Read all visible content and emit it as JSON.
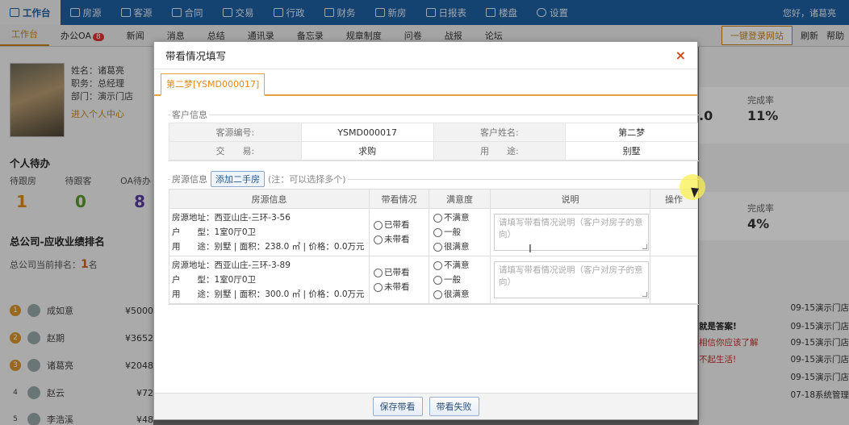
{
  "topnav": {
    "tabs": [
      {
        "label": "工作台",
        "icon": "grid-icon"
      },
      {
        "label": "房源",
        "icon": "home-icon"
      },
      {
        "label": "客源",
        "icon": "users-icon"
      },
      {
        "label": "合同",
        "icon": "contract-icon"
      },
      {
        "label": "交易",
        "icon": "trade-icon"
      },
      {
        "label": "行政",
        "icon": "admin-icon"
      },
      {
        "label": "财务",
        "icon": "finance-icon"
      },
      {
        "label": "新房",
        "icon": "newhouse-icon"
      },
      {
        "label": "日报表",
        "icon": "report-icon"
      },
      {
        "label": "楼盘",
        "icon": "building-icon"
      },
      {
        "label": "设置",
        "icon": "gear-icon"
      }
    ],
    "greeting": "您好，诸葛亮"
  },
  "subnav": {
    "items": [
      "工作台",
      "办公OA",
      "新闻",
      "消息",
      "总结",
      "通讯录",
      "备忘录",
      "规章制度",
      "问卷",
      "战报",
      "论坛"
    ],
    "oa_badge": "8",
    "login_btn": "一键登录网站",
    "refresh": "刷新",
    "help": "帮助"
  },
  "profile": {
    "name": "姓名：诸葛亮",
    "title": "职务：总经理",
    "dept": "部门：演示门店",
    "enter": "进入个人中心"
  },
  "todo": {
    "title": "个人待办",
    "labels": [
      "待跟房",
      "待跟客",
      "OA待办"
    ],
    "values": [
      "1",
      "0",
      "8"
    ],
    "value_colors": [
      "#e08a1a",
      "#5a9a2a",
      "#5a3aa0"
    ]
  },
  "ranking": {
    "title": "总公司-应收业绩排名",
    "line_prefix": "总公司当前排名：",
    "line_rank": "1",
    "line_suffix": "名",
    "rows": [
      {
        "no": "1",
        "name": "成如意",
        "amount": "¥5000"
      },
      {
        "no": "2",
        "name": "赵期",
        "amount": "¥3652"
      },
      {
        "no": "3",
        "name": "诸葛亮",
        "amount": "¥2048"
      },
      {
        "no": "4",
        "name": "赵云",
        "amount": "¥72"
      },
      {
        "no": "5",
        "name": "李浩溪",
        "amount": "¥48"
      }
    ]
  },
  "right_panel": {
    "rate_label": "完成率",
    "rate1": "11%",
    "rate2": "4%",
    "zero": ".0",
    "news": [
      {
        "text": "",
        "date": "09-15演示门店"
      },
      {
        "text": "就是答案!",
        "date": "09-15演示门店"
      },
      {
        "text": "相信你应该了解",
        "date": "09-15演示门店"
      },
      {
        "text": "不起生活!",
        "date": "09-15演示门店"
      },
      {
        "text": "",
        "date": "09-15演示门店"
      },
      {
        "text": "",
        "date": "07-18系统管理"
      }
    ]
  },
  "modal": {
    "title": "带看情况填写",
    "close": "×",
    "tab": "第二梦[YSMD000017]",
    "customer": {
      "legend": "客户信息",
      "rows": [
        [
          "客源编号:",
          "YSMD000017",
          "客户姓名:",
          "第二梦"
        ],
        [
          "交　　易:",
          "求购",
          "用　　途:",
          "别墅"
        ]
      ]
    },
    "house": {
      "legend": "房源信息",
      "add_btn": "添加二手房",
      "note": "(注：可以选择多个)",
      "headers": [
        "房源信息",
        "带看情况",
        "满意度",
        "说明",
        "操作"
      ],
      "rows": [
        {
          "addr": "房源地址：西亚山庄-三环-3-56",
          "type": "户　　型：1室0厅0卫",
          "use": "用　　途：别墅 | 面积：238.0 ㎡ | 价格：0.0万元",
          "look_opts": [
            "已带看",
            "未带看"
          ],
          "sat_opts": [
            "不满意",
            "一般",
            "很满意"
          ],
          "placeholder": "请填写带看情况说明（客户对房子的意向）"
        },
        {
          "addr": "房源地址：西亚山庄-三环-3-89",
          "type": "户　　型：1室0厅0卫",
          "use": "用　　途：别墅 | 面积：300.0 ㎡ | 价格：0.0万元",
          "look_opts": [
            "已带看",
            "未带看"
          ],
          "sat_opts": [
            "不满意",
            "一般",
            "很满意"
          ],
          "placeholder": "请填写带看情况说明（客户对房子的意向）"
        }
      ]
    },
    "save_btn": "保存带看",
    "fail_btn": "带看失败"
  }
}
